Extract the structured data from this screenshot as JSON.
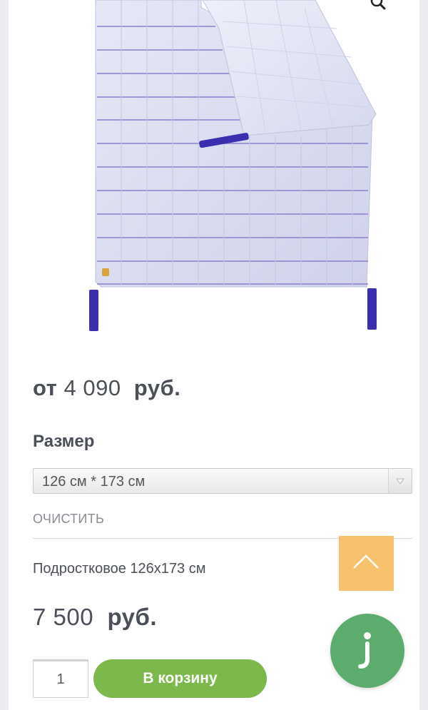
{
  "product": {
    "price_from": {
      "prefix": "от",
      "amount": "4 090",
      "currency": "руб."
    }
  },
  "options": {
    "size_label": "Размер",
    "size_selected": "126 см * 173 см",
    "clear_label": "ОЧИСТИТЬ"
  },
  "variant": {
    "description": "Подростковое 126х173 см",
    "price_amount": "7 500",
    "price_currency": "руб."
  },
  "cart": {
    "quantity": "1",
    "add_label": "В корзину"
  },
  "colors": {
    "accent_green": "#7cb84b",
    "scroll_top_bg": "#f6c06d",
    "chat_bg": "#5cac6e",
    "blanket": "#d9dcef",
    "strap": "#3b2fb0"
  },
  "icons": {
    "zoom": "magnifier-icon",
    "scroll_top": "chevron-up-icon",
    "chat": "chat-icon",
    "select_arrow": "triangle-down-icon"
  }
}
